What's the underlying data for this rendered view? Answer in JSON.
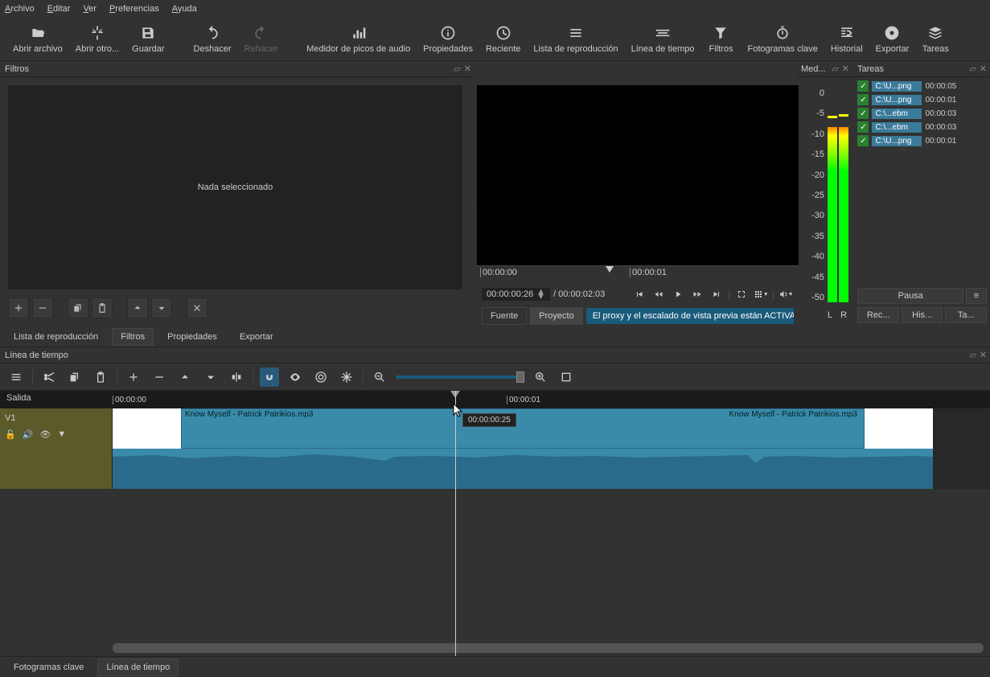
{
  "menu": {
    "archivo": "Archivo",
    "editar": "Editar",
    "ver": "Ver",
    "preferencias": "Preferencias",
    "ayuda": "Ayuda"
  },
  "toolbar": {
    "abrir_archivo": "Abrir archivo",
    "abrir_otro": "Abrir otro...",
    "guardar": "Guardar",
    "deshacer": "Deshacer",
    "rehacer": "Rehacer",
    "medidor": "Medidor de picos de audio",
    "propiedades": "Propiedades",
    "reciente": "Reciente",
    "lista": "Lista de reproducción",
    "linea": "Línea de tiempo",
    "filtros": "Filtros",
    "fotogramas": "Fotogramas clave",
    "historial": "Historial",
    "exportar": "Exportar",
    "tareas": "Tareas"
  },
  "filters": {
    "title": "Filtros",
    "nothing": "Nada seleccionado"
  },
  "player": {
    "ruler_t0": "00:00:00",
    "ruler_t1": "00:00:01",
    "time_current": "00:00:00:26",
    "time_total": "/ 00:00:02:03",
    "tab_fuente": "Fuente",
    "tab_proyecto": "Proyecto",
    "proxy_msg": "El proxy y el escalado de vista previa están ACTIVA..."
  },
  "meters": {
    "title": "Med...",
    "scale": [
      "0",
      "-5",
      "-10",
      "-15",
      "-20",
      "-25",
      "-30",
      "-35",
      "-40",
      "-45",
      "-50"
    ],
    "L": "L",
    "R": "R"
  },
  "tasks": {
    "title": "Tareas",
    "items": [
      {
        "name": "C:\\U...png",
        "time": "00:00:05"
      },
      {
        "name": "C:\\U...png",
        "time": "00:00:01"
      },
      {
        "name": "C:\\...ebm",
        "time": "00:00:03"
      },
      {
        "name": "C:\\...ebm",
        "time": "00:00:03"
      },
      {
        "name": "C:\\U...png",
        "time": "00:00:01"
      }
    ],
    "pausa": "Pausa",
    "rec": "Rec...",
    "his": "His...",
    "ta": "Ta..."
  },
  "mid_tabs": {
    "lista": "Lista de reproducción",
    "filtros": "Filtros",
    "propiedades": "Propiedades",
    "exportar": "Exportar"
  },
  "timeline": {
    "title": "Línea de tiempo",
    "salida": "Salida",
    "t0": "00:00:00",
    "t1": "00:00:01",
    "track": "V1",
    "clip1": "Know Myself - Patrick Patrikios.mp3",
    "clip2": "Know Myself - Patrick Patrikios.mp3",
    "tooltip": "00:00:00:25"
  },
  "bottom_tabs": {
    "fotogramas": "Fotogramas clave",
    "linea": "Línea de tiempo"
  }
}
